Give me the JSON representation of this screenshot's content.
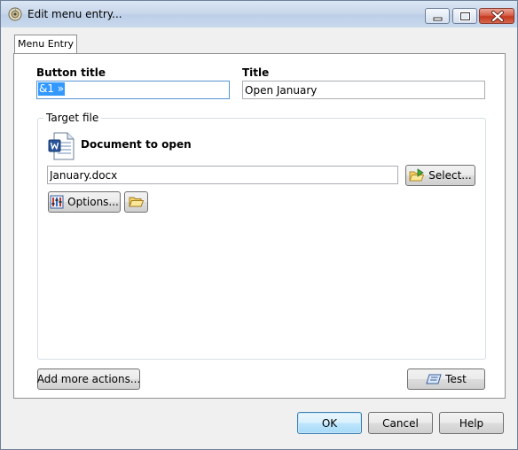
{
  "window": {
    "title": "Edit menu entry...",
    "controls": {
      "minimize": "minimize",
      "maximize": "maximize",
      "close": "close"
    }
  },
  "tabs": [
    {
      "label": "Menu Entry",
      "active": true
    }
  ],
  "form": {
    "button_title": {
      "label": "Button title",
      "value": "&1 »"
    },
    "title": {
      "label": "Title",
      "value": "Open January"
    }
  },
  "target": {
    "group_label": "Target file",
    "heading": "Document to open",
    "file_value": "January.docx",
    "select_label": "Select...",
    "options_label": "Options..."
  },
  "actions": {
    "add_more_label": "Add more actions...",
    "test_label": "Test"
  },
  "footer": {
    "ok_label": "OK",
    "cancel_label": "Cancel",
    "help_label": "Help"
  },
  "icons": {
    "app": "app-icon",
    "document": "word-document-icon",
    "select": "folder-arrow-icon",
    "options": "options-icon",
    "open_folder": "open-folder-icon",
    "test": "test-icon"
  },
  "colors": {
    "selection": "#3399ff",
    "focus_border": "#5694d3",
    "close_button": "#c4391f"
  }
}
